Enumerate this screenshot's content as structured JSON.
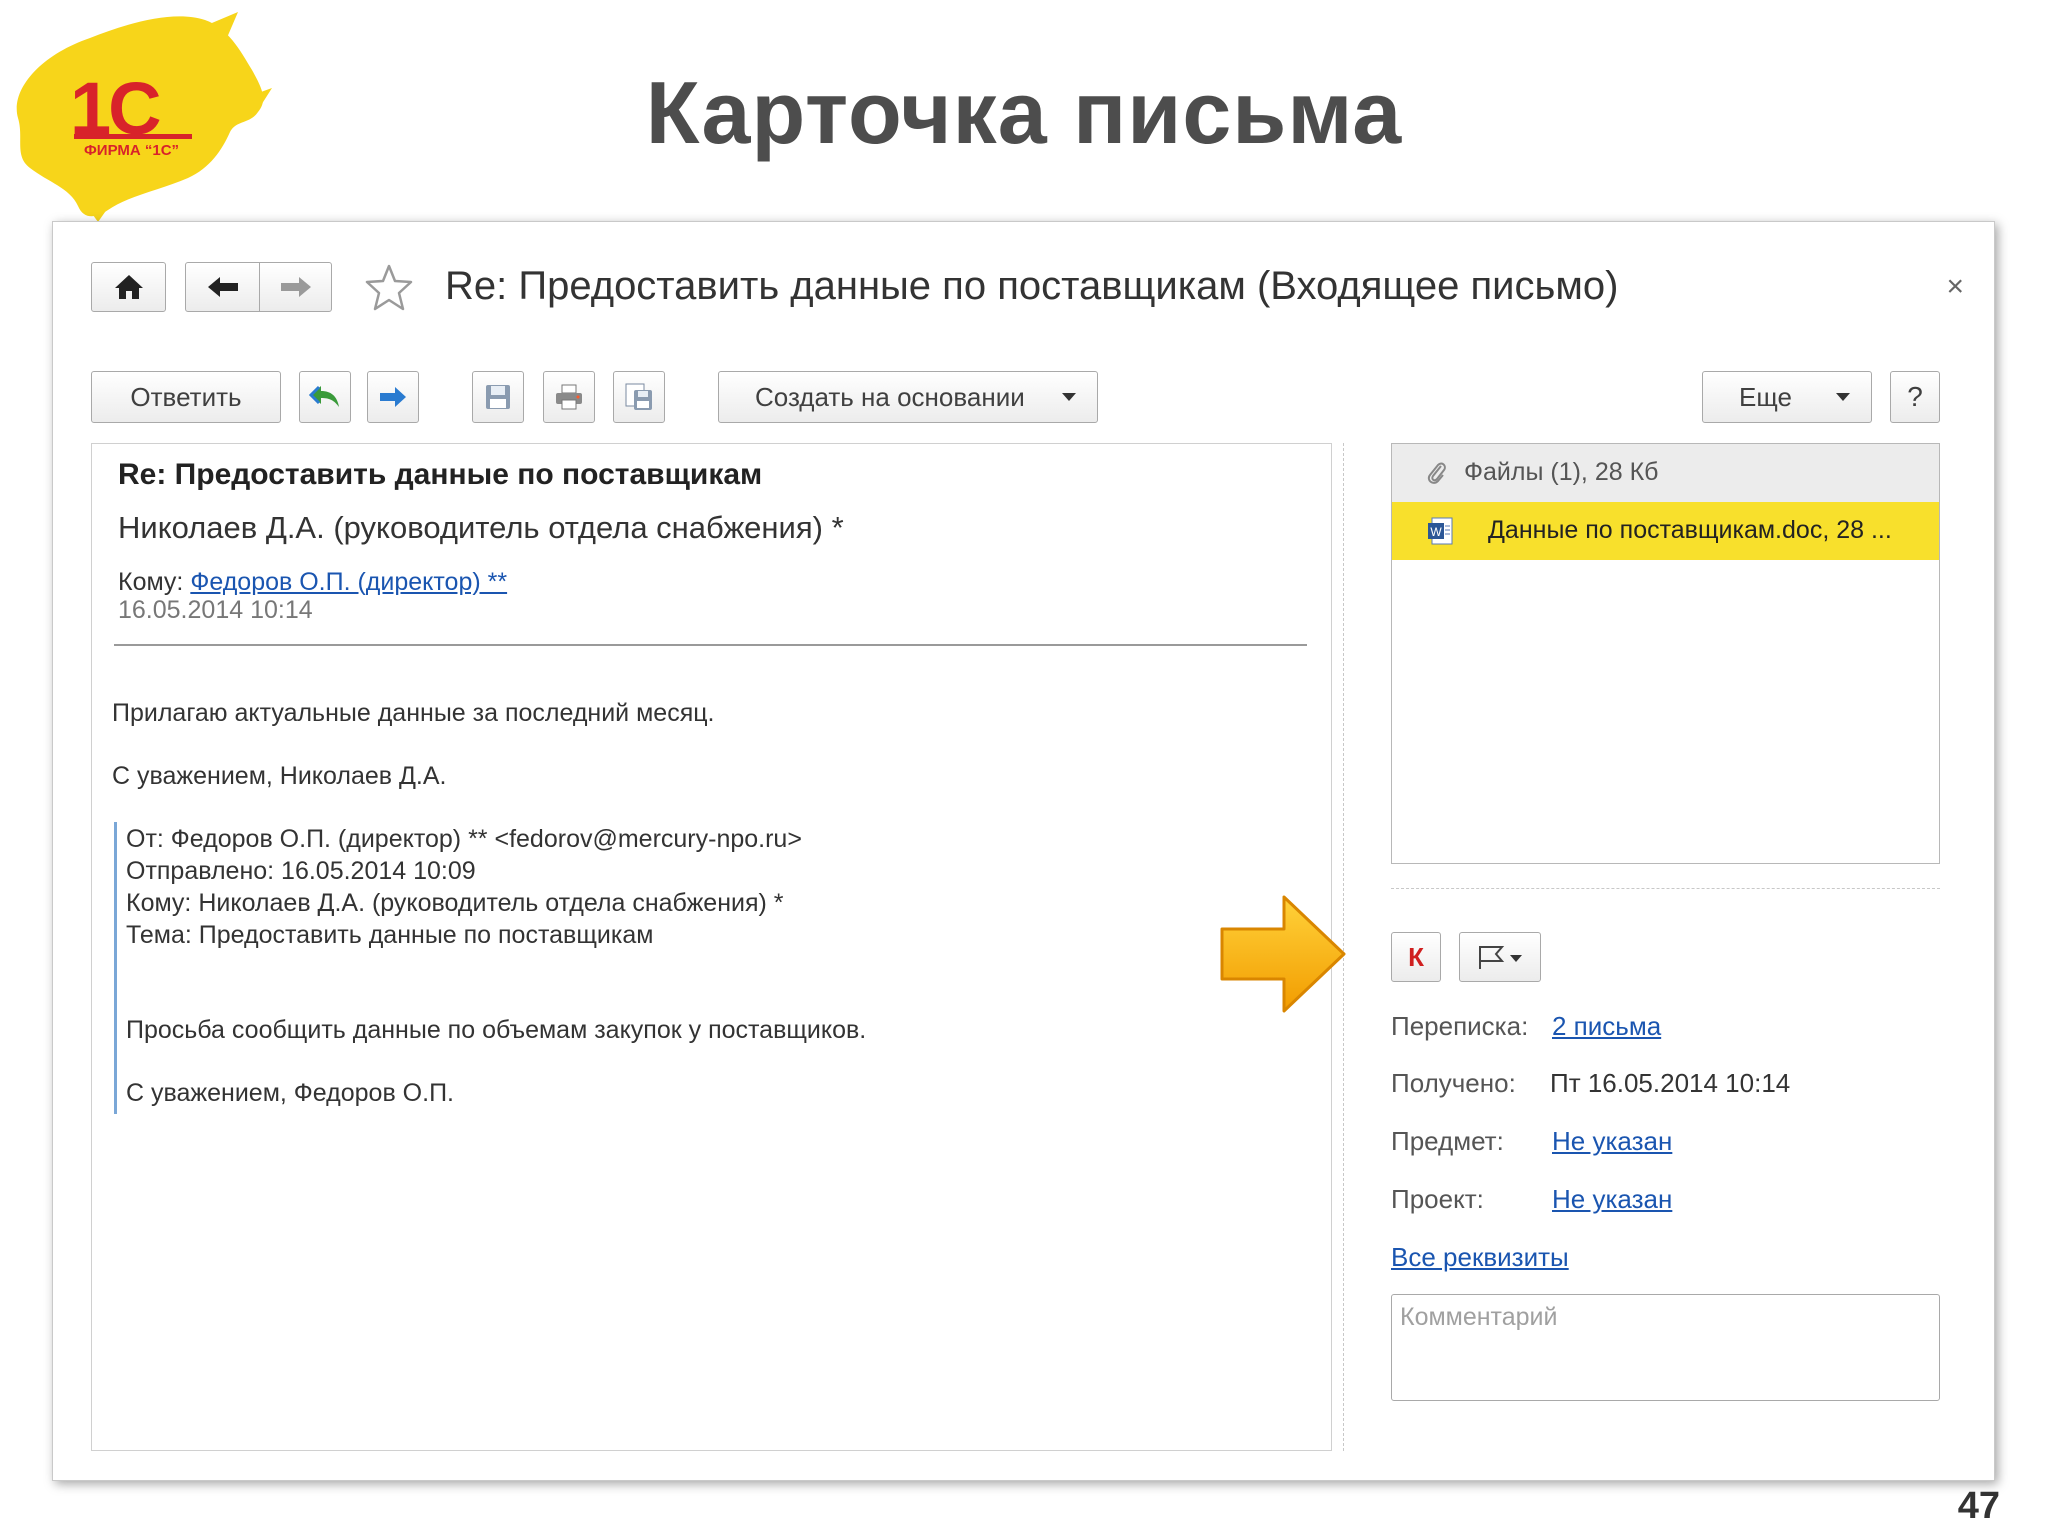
{
  "slide": {
    "title": "Карточка письма",
    "page_number": "47",
    "logo": {
      "brand_text": "1С",
      "sub_text": "ФИРМА “1С”",
      "colors": {
        "yellow": "#f7d51a",
        "red": "#d8232a"
      }
    }
  },
  "window": {
    "title": "Re: Предоставить данные по поставщикам (Входящее письмо)",
    "close_glyph": "×",
    "nav": {
      "home_icon": "home-icon",
      "back_icon": "arrow-left-icon",
      "forward_icon": "arrow-right-icon",
      "favorite_icon": "star-icon"
    }
  },
  "toolbar": {
    "reply_label": "Ответить",
    "create_based_label": "Создать на основании",
    "more_label": "Еще",
    "help_label": "?",
    "icons": [
      "reply-all-icon",
      "forward-icon",
      "save-icon",
      "print-icon",
      "save-as-icon"
    ]
  },
  "message": {
    "subject": "Re: Предоставить данные по поставщикам",
    "from": "Николаев Д.А. (руководитель отдела снабжения) *",
    "to_label": "Кому:",
    "to_value": "Федоров О.П. (директор) **",
    "date": "16.05.2014 10:14",
    "body": [
      "Прилагаю актуальные данные за последний месяц.",
      "С уважением, Николаев Д.А."
    ],
    "quote": {
      "from_line": "От: Федоров О.П. (директор) ** <fedorov@mercury-npo.ru>",
      "sent_line": "Отправлено: 16.05.2014 10:09",
      "to_line": "Кому: Николаев Д.А. (руководитель отдела снабжения) *",
      "subject_line": "Тема: Предоставить данные по поставщикам",
      "body": "Просьба сообщить данные по объемам закупок у поставщиков.",
      "signature": "С уважением, Федоров О.П."
    }
  },
  "attachments": {
    "header": "Файлы (1), 28 Кб",
    "items": [
      {
        "name": "Данные по поставщикам.doc, 28 ...",
        "icon": "word-doc-icon"
      }
    ],
    "highlight_color": "#f8e02c"
  },
  "side": {
    "importance_label": "К",
    "flag_icon": "flag-icon",
    "correspondence_label": "Переписка:",
    "correspondence_value": "2 письма",
    "received_label": "Получено:",
    "received_value": "Пт 16.05.2014 10:14",
    "subject_label": "Предмет:",
    "subject_value": "Не указан",
    "project_label": "Проект:",
    "project_value": "Не указан",
    "all_props_link": "Все реквизиты",
    "comment_placeholder": "Комментарий"
  },
  "callout": {
    "icon": "arrow-right-callout-icon",
    "color": "#f7b500"
  }
}
